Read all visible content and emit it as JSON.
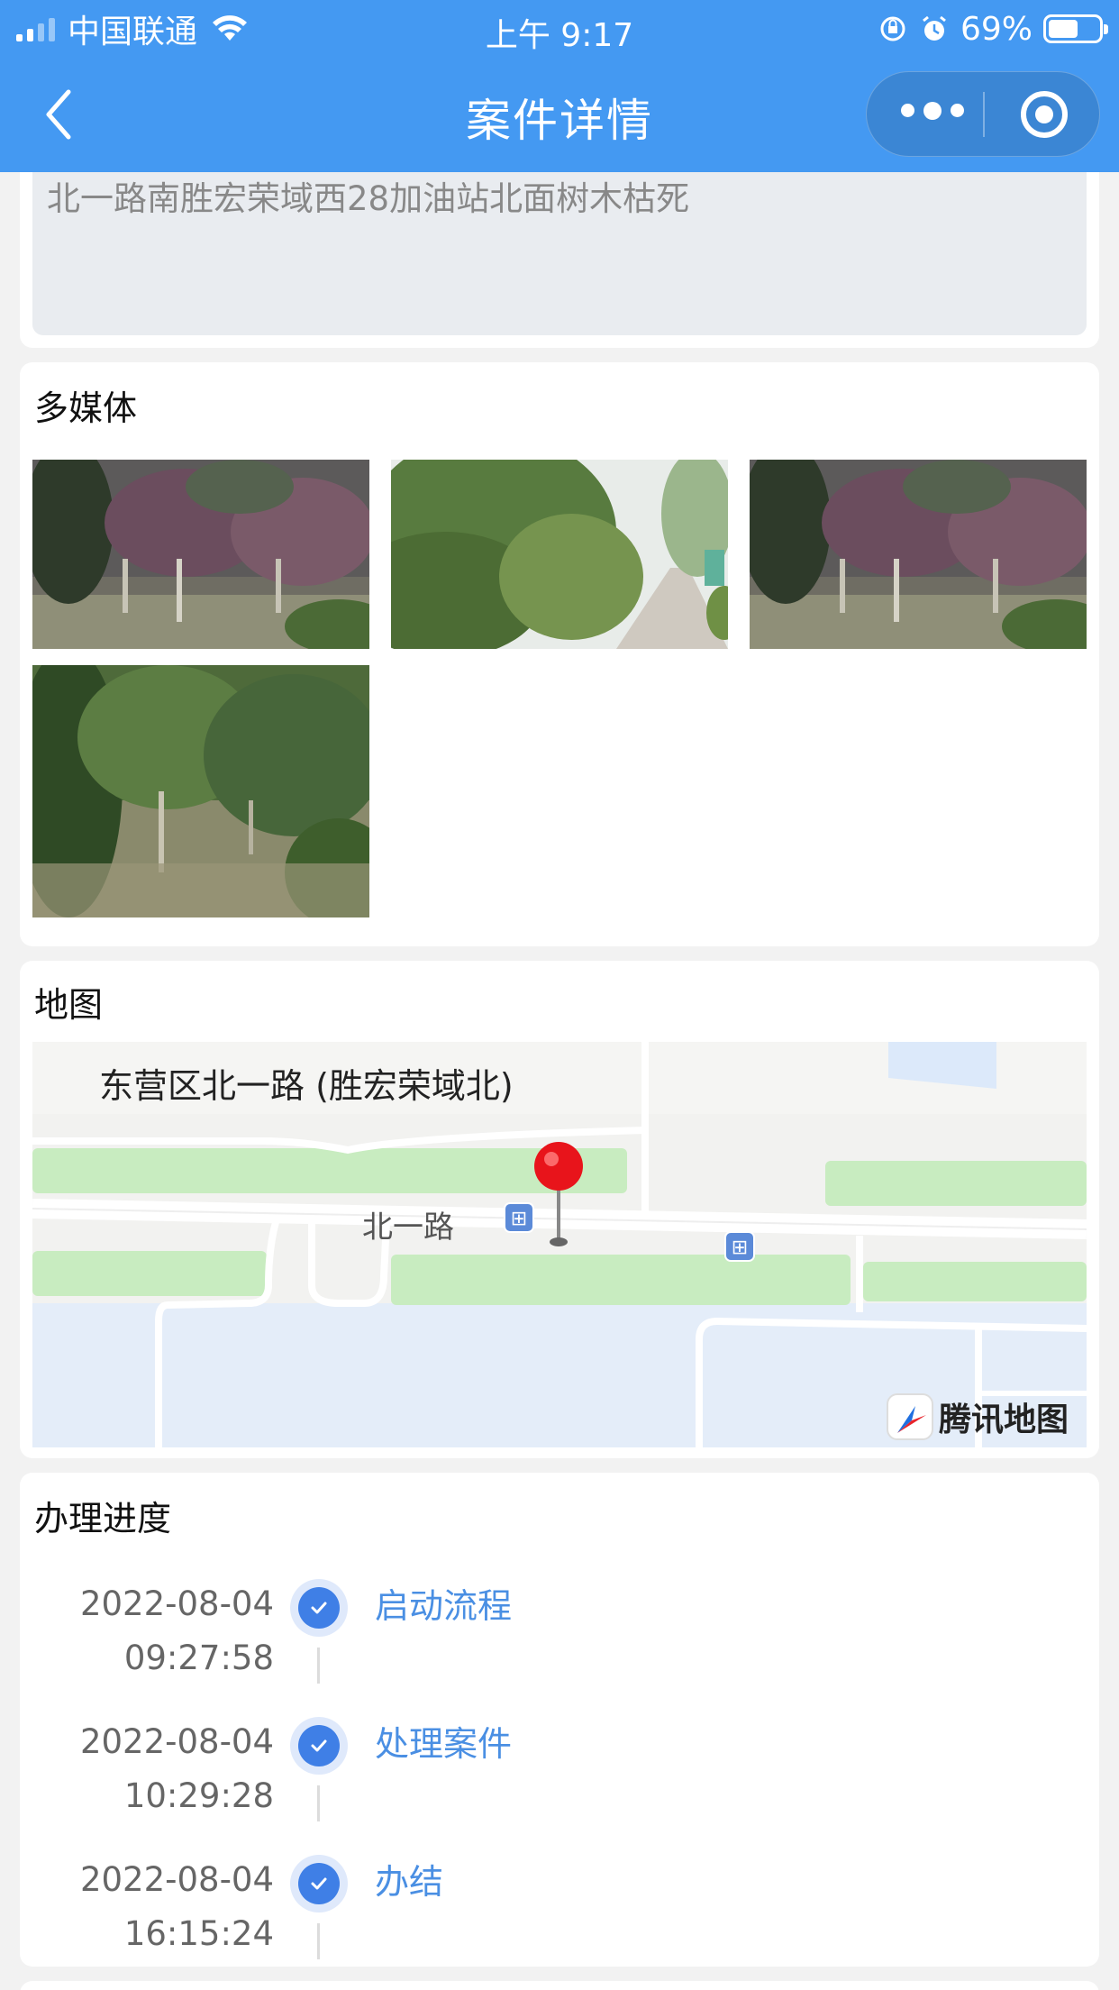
{
  "status_bar": {
    "carrier": "中国联通",
    "time": "上午 9:17",
    "battery": "69%",
    "battery_level": 0.69,
    "icons": [
      "signal-icon",
      "wifi-icon",
      "orientation-lock-icon",
      "alarm-icon",
      "battery-icon"
    ]
  },
  "navbar": {
    "title": "案件详情",
    "back_icon": "chevron-left-icon",
    "more_icon": "more-dots-icon",
    "close_icon": "target-icon"
  },
  "colors": {
    "header_bg": "#4499f2",
    "accent": "#4a8fe3",
    "page_bg": "#f2f2f2"
  },
  "description": {
    "text": "北一路南胜宏荣域西28加油站北面树木枯死"
  },
  "media": {
    "title": "多媒体",
    "images": [
      "tree-photo-1",
      "road-photo-2",
      "tree-photo-3",
      "tree-photo-4"
    ]
  },
  "map": {
    "title": "地图",
    "location_label": "东营区北一路 (胜宏荣域北)",
    "road_label": "北一路",
    "provider": "腾讯地图",
    "bus_icon_text": "⊞"
  },
  "progress": {
    "title": "办理进度",
    "steps": [
      {
        "date": "2022-08-04",
        "time": "09:27:58",
        "label": "启动流程"
      },
      {
        "date": "2022-08-04",
        "time": "10:29:28",
        "label": "处理案件"
      },
      {
        "date": "2022-08-04",
        "time": "16:15:24",
        "label": "办结"
      }
    ]
  }
}
